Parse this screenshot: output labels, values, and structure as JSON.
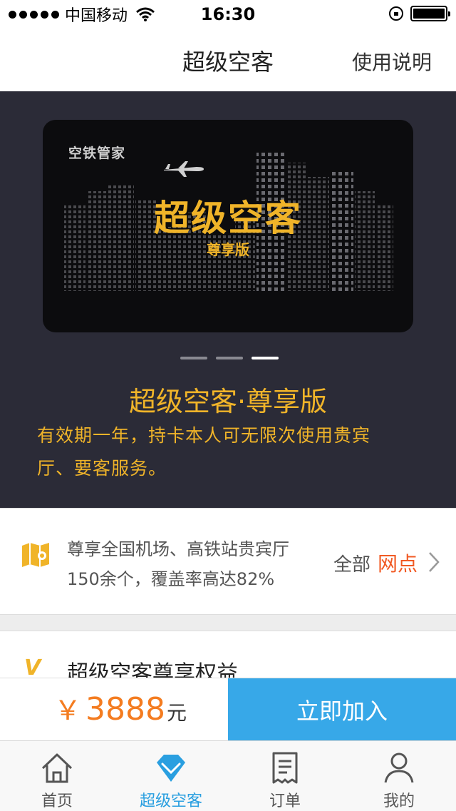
{
  "status_bar": {
    "carrier": "中国移动",
    "time": "16:30"
  },
  "nav": {
    "title": "超级空客",
    "help": "使用说明"
  },
  "banner": {
    "brand": "空铁管家",
    "card_title": "超级空客",
    "card_subtitle": "尊享版",
    "pager_count": 3,
    "active_page": 3
  },
  "hero": {
    "title": "超级空客·尊享版",
    "desc_line1": "有效期一年，持卡本人可无限次使用贵宾",
    "desc_line2": "厅、要客服务。"
  },
  "venues": {
    "line1": "尊享全国机场、高铁站贵宾厅",
    "line2": "150余个，覆盖率高达82%",
    "all_label": "全部",
    "link_label": "网点"
  },
  "benefits": {
    "title": "超级空客尊享权益"
  },
  "buy": {
    "currency": "￥",
    "price": "3888",
    "unit": "元",
    "join_label": "立即加入"
  },
  "tabs": [
    {
      "label": "首页",
      "icon": "home-icon"
    },
    {
      "label": "超级空客",
      "icon": "diamond-icon"
    },
    {
      "label": "订单",
      "icon": "receipt-icon"
    },
    {
      "label": "我的",
      "icon": "user-icon"
    }
  ],
  "colors": {
    "accent_gold": "#f0b429",
    "accent_blue": "#37a8e8",
    "link_orange": "#f15a24",
    "hero_bg": "#2b2b37"
  }
}
